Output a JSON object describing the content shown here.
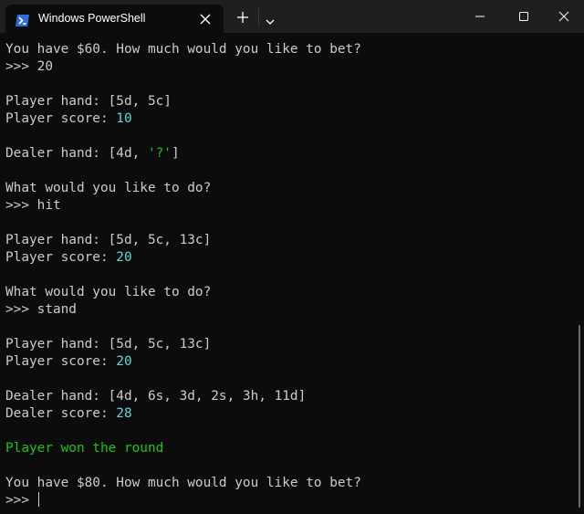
{
  "window": {
    "tab_title": "Windows PowerShell"
  },
  "colors": {
    "text": "#cccccc",
    "number": "#61d6d6",
    "string": "#16c60c",
    "success": "#16c60c",
    "background": "#0c0c0c",
    "titlebar": "#1f1f1f"
  },
  "icons": {
    "tab": "powershell-icon",
    "tab_close": "close-icon",
    "new_tab": "plus-icon",
    "dropdown": "chevron-down-icon",
    "minimize": "minimize-icon",
    "maximize": "maximize-icon",
    "close": "close-icon"
  },
  "terminal": {
    "lines": [
      {
        "segments": [
          {
            "text": "You have $60. How much would you like to bet?"
          }
        ]
      },
      {
        "segments": [
          {
            "text": ">>> 20"
          }
        ]
      },
      {
        "segments": [
          {
            "text": ""
          }
        ]
      },
      {
        "segments": [
          {
            "text": "Player hand: [5d, 5c]"
          }
        ]
      },
      {
        "segments": [
          {
            "text": "Player score: "
          },
          {
            "text": "10",
            "color": "number"
          }
        ]
      },
      {
        "segments": [
          {
            "text": ""
          }
        ]
      },
      {
        "segments": [
          {
            "text": "Dealer hand: [4d, "
          },
          {
            "text": "'?'",
            "color": "string"
          },
          {
            "text": "]"
          }
        ]
      },
      {
        "segments": [
          {
            "text": ""
          }
        ]
      },
      {
        "segments": [
          {
            "text": "What would you like to do?"
          }
        ]
      },
      {
        "segments": [
          {
            "text": ">>> hit"
          }
        ]
      },
      {
        "segments": [
          {
            "text": ""
          }
        ]
      },
      {
        "segments": [
          {
            "text": "Player hand: [5d, 5c, 13c]"
          }
        ]
      },
      {
        "segments": [
          {
            "text": "Player score: "
          },
          {
            "text": "20",
            "color": "number"
          }
        ]
      },
      {
        "segments": [
          {
            "text": ""
          }
        ]
      },
      {
        "segments": [
          {
            "text": "What would you like to do?"
          }
        ]
      },
      {
        "segments": [
          {
            "text": ">>> stand"
          }
        ]
      },
      {
        "segments": [
          {
            "text": ""
          }
        ]
      },
      {
        "segments": [
          {
            "text": "Player hand: [5d, 5c, 13c]"
          }
        ]
      },
      {
        "segments": [
          {
            "text": "Player score: "
          },
          {
            "text": "20",
            "color": "number"
          }
        ]
      },
      {
        "segments": [
          {
            "text": ""
          }
        ]
      },
      {
        "segments": [
          {
            "text": "Dealer hand: [4d, 6s, 3d, 2s, 3h, 11d]"
          }
        ]
      },
      {
        "segments": [
          {
            "text": "Dealer score: "
          },
          {
            "text": "28",
            "color": "number"
          }
        ]
      },
      {
        "segments": [
          {
            "text": ""
          }
        ]
      },
      {
        "segments": [
          {
            "text": "Player won the round",
            "color": "success"
          }
        ]
      },
      {
        "segments": [
          {
            "text": ""
          }
        ]
      },
      {
        "segments": [
          {
            "text": "You have $80. How much would you like to bet?"
          }
        ]
      },
      {
        "segments": [
          {
            "text": ">>> "
          }
        ],
        "cursor": true
      }
    ]
  }
}
